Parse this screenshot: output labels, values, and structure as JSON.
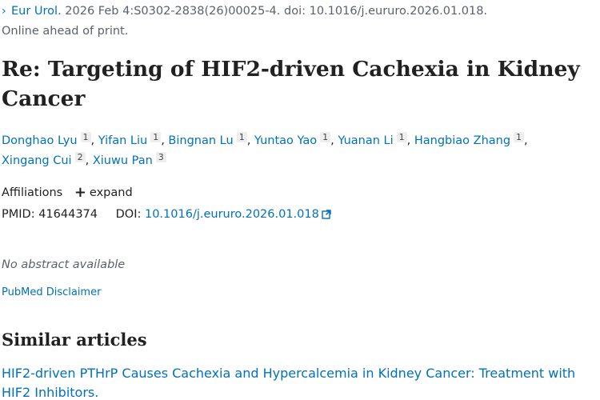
{
  "citation": {
    "journal": "Eur Urol.",
    "details": " 2026 Feb 4:S0302-2838(26)00025-4. doi: 10.1016/j.eururo.2026.01.018.",
    "status": "Online ahead of print."
  },
  "title": "Re: Targeting of HIF2-driven Cachexia in Kidney Cancer",
  "authors": [
    {
      "name": "Donghao Lyu",
      "aff": "1",
      "sep": ","
    },
    {
      "name": "Yifan Liu",
      "aff": "1",
      "sep": ","
    },
    {
      "name": "Bingnan Lu",
      "aff": "1",
      "sep": ","
    },
    {
      "name": "Yuntao Yao",
      "aff": "1",
      "sep": ","
    },
    {
      "name": "Yuanan Li",
      "aff": "1",
      "sep": ","
    },
    {
      "name": "Hangbiao Zhang",
      "aff": "1",
      "sep": ","
    },
    {
      "name": "Xingang Cui",
      "aff": "2",
      "sep": ","
    },
    {
      "name": "Xiuwu Pan",
      "aff": "3",
      "sep": ""
    }
  ],
  "affiliations": {
    "label": "Affiliations",
    "expand_label": "expand"
  },
  "identifiers": {
    "pmid_label": "PMID:",
    "pmid": "41644374",
    "doi_label": "DOI:",
    "doi": "10.1016/j.eururo.2026.01.018"
  },
  "abstract_text": "No abstract available",
  "disclaimer": "PubMed Disclaimer",
  "similar": {
    "heading": "Similar articles",
    "items": [
      "HIF2-driven PTHrP Causes Cachexia and Hypercalcemia in Kidney Cancer: Treatment with HIF2 Inhibitors."
    ]
  },
  "icons": {
    "journal_toggle": "chevron-right-icon",
    "expand": "plus-icon",
    "doi_link": "external-link-icon"
  },
  "colors": {
    "link": "#0071bc",
    "text": "#212121",
    "muted": "#5b616b"
  }
}
